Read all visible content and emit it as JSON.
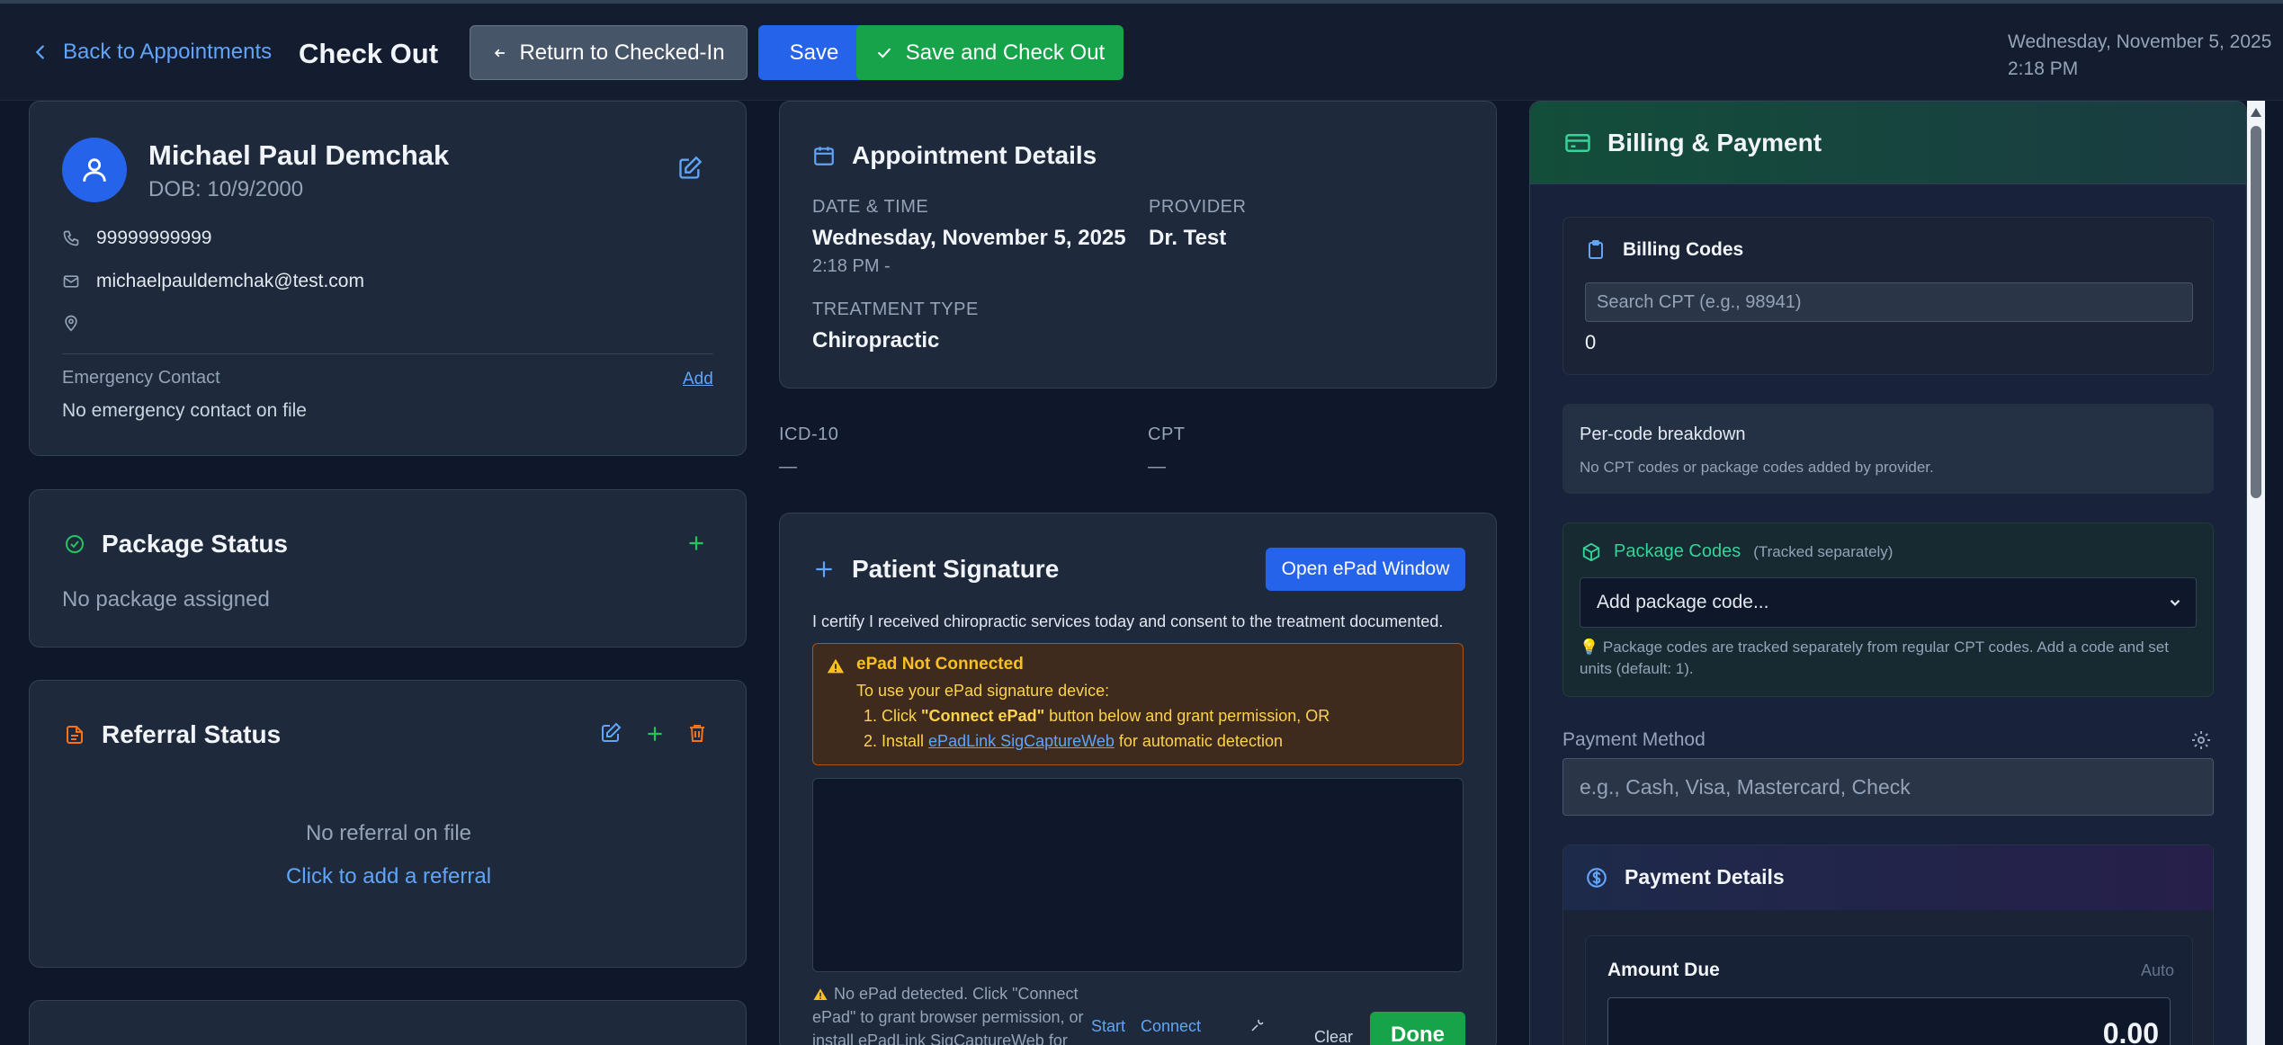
{
  "header": {
    "back_label": "Back to Appointments",
    "title": "Check Out",
    "return_label": "Return to Checked-In",
    "save_label": "Save",
    "save_checkout_label": "Save and Check Out",
    "date": "Wednesday, November 5, 2025",
    "time": "2:18 PM"
  },
  "patient": {
    "name": "Michael Paul Demchak",
    "dob": "DOB: 10/9/2000",
    "phone": "99999999999",
    "email": "michaelpauldemchak@test.com",
    "address": "",
    "emergency_label": "Emergency Contact",
    "emergency_add": "Add",
    "emergency_value": "No emergency contact on file"
  },
  "package_status": {
    "title": "Package Status",
    "value": "No package assigned"
  },
  "referral_status": {
    "title": "Referral Status",
    "empty": "No referral on file",
    "add_link": "Click to add a referral"
  },
  "appointment": {
    "title": "Appointment Details",
    "date_label": "DATE & TIME",
    "date_value": "Wednesday, November 5, 2025",
    "time_value": "2:18 PM -",
    "provider_label": "PROVIDER",
    "provider_value": "Dr. Test",
    "treatment_label": "TREATMENT TYPE",
    "treatment_value": "Chiropractic"
  },
  "codes": {
    "icd_label": "ICD-10",
    "icd_value": "—",
    "cpt_label": "CPT",
    "cpt_value": "—"
  },
  "signature": {
    "title": "Patient Signature",
    "open_epad": "Open ePad Window",
    "certify": "I certify I received chiropractic services today and consent to the treatment documented.",
    "warn_title": "ePad Not Connected",
    "warn_intro": "To use your ePad signature device:",
    "warn_step1_prefix": "1. Click ",
    "warn_step1_bold": "\"Connect ePad\"",
    "warn_step1_suffix": " button below and grant permission, OR",
    "warn_step2_prefix": "2. Install ",
    "warn_step2_link": "ePadLink SigCaptureWeb",
    "warn_step2_suffix": " for automatic detection",
    "footer_line1": "No ePad detected. Click \"Connect",
    "footer_line2": "ePad\" to grant browser permission, or",
    "footer_line3": "install ePadLink SigCaptureWeb for",
    "start": "Start",
    "connect": "Connect",
    "clear": "Clear",
    "done": "Done"
  },
  "billing": {
    "title": "Billing & Payment",
    "codes_title": "Billing Codes",
    "search_placeholder": "Search CPT (e.g., 98941)",
    "codes_count": "0",
    "breakdown_title": "Per-code breakdown",
    "breakdown_empty": "No CPT codes or package codes added by provider.",
    "package_title": "Package Codes",
    "package_note": "(Tracked separately)",
    "package_select": "Add package code...",
    "package_hint_line1": "💡 Package codes are tracked separately from regular CPT codes. Add a code and set",
    "package_hint_line2": "units (default: 1).",
    "payment_method_label": "Payment Method",
    "payment_method_placeholder": "e.g., Cash, Visa, Mastercard, Check",
    "payment_details_title": "Payment Details",
    "amount_due_label": "Amount Due",
    "amount_due_mode": "Auto",
    "amount_due_value": "0.00"
  },
  "colors": {
    "background": "#0f172a",
    "card": "#1e293b",
    "accent_blue": "#2563eb",
    "accent_green": "#16a34a",
    "warning": "#fbbf24"
  }
}
